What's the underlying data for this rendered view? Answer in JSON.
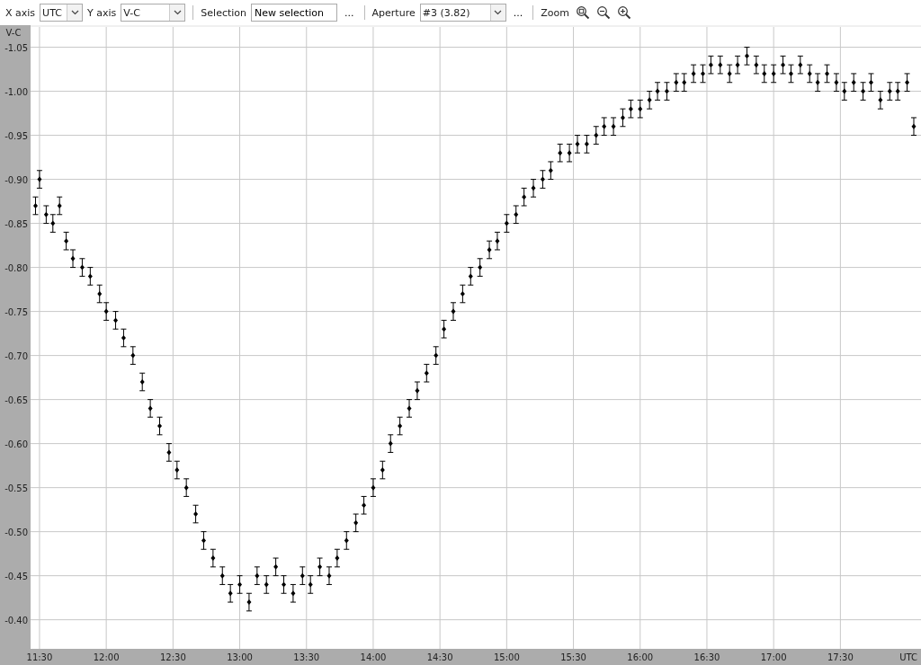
{
  "toolbar": {
    "x_axis": {
      "label": "X axis",
      "value": "UTC"
    },
    "y_axis": {
      "label": "Y axis",
      "value": "V-C"
    },
    "selection": {
      "label": "Selection",
      "value": "New selection",
      "more": "..."
    },
    "aperture": {
      "label": "Aperture",
      "value": "#3 (3.82)",
      "more": "..."
    },
    "zoom": {
      "label": "Zoom"
    }
  },
  "chart": {
    "chart_data": {
      "type": "scatter",
      "xlabel": "UTC",
      "ylabel": "V-C",
      "grid": true,
      "xlim": [
        11.433,
        18.104
      ],
      "ylim": [
        -0.367,
        -1.073
      ],
      "xticks": [
        {
          "value": 11.5,
          "label": "11:30"
        },
        {
          "value": 12,
          "label": "12:00"
        },
        {
          "value": 12.5,
          "label": "12:30"
        },
        {
          "value": 13,
          "label": "13:00"
        },
        {
          "value": 13.5,
          "label": "13:30"
        },
        {
          "value": 14,
          "label": "14:00"
        },
        {
          "value": 14.5,
          "label": "14:30"
        },
        {
          "value": 15,
          "label": "15:00"
        },
        {
          "value": 15.5,
          "label": "15:30"
        },
        {
          "value": 16,
          "label": "16:00"
        },
        {
          "value": 16.5,
          "label": "16:30"
        },
        {
          "value": 17,
          "label": "17:00"
        },
        {
          "value": 17.5,
          "label": "17:30"
        }
      ],
      "yticks": [
        {
          "value": -1.05,
          "label": "-1.05"
        },
        {
          "value": -1.0,
          "label": "-1.00"
        },
        {
          "value": -0.95,
          "label": "-0.95"
        },
        {
          "value": -0.9,
          "label": "-0.90"
        },
        {
          "value": -0.85,
          "label": "-0.85"
        },
        {
          "value": -0.8,
          "label": "-0.80"
        },
        {
          "value": -0.75,
          "label": "-0.75"
        },
        {
          "value": -0.7,
          "label": "-0.70"
        },
        {
          "value": -0.65,
          "label": "-0.65"
        },
        {
          "value": -0.6,
          "label": "-0.60"
        },
        {
          "value": -0.55,
          "label": "-0.55"
        },
        {
          "value": -0.5,
          "label": "-0.50"
        },
        {
          "value": -0.45,
          "label": "-0.45"
        },
        {
          "value": -0.4,
          "label": "-0.40"
        }
      ],
      "x": [
        11.47,
        11.5,
        11.55,
        11.6,
        11.65,
        11.7,
        11.75,
        11.82,
        11.88,
        11.95,
        12.0,
        12.07,
        12.13,
        12.2,
        12.27,
        12.33,
        12.4,
        12.47,
        12.53,
        12.6,
        12.67,
        12.73,
        12.8,
        12.87,
        12.93,
        13.0,
        13.07,
        13.13,
        13.2,
        13.27,
        13.33,
        13.4,
        13.47,
        13.53,
        13.6,
        13.67,
        13.73,
        13.8,
        13.87,
        13.93,
        14.0,
        14.07,
        14.13,
        14.2,
        14.27,
        14.33,
        14.4,
        14.47,
        14.53,
        14.6,
        14.67,
        14.73,
        14.8,
        14.87,
        14.93,
        15.0,
        15.07,
        15.13,
        15.2,
        15.27,
        15.33,
        15.4,
        15.47,
        15.53,
        15.6,
        15.67,
        15.73,
        15.8,
        15.87,
        15.93,
        16.0,
        16.07,
        16.13,
        16.2,
        16.27,
        16.33,
        16.4,
        16.47,
        16.53,
        16.6,
        16.67,
        16.73,
        16.8,
        16.87,
        16.93,
        17.0,
        17.07,
        17.13,
        17.2,
        17.27,
        17.33,
        17.4,
        17.47,
        17.53,
        17.6,
        17.67,
        17.73,
        17.8,
        17.87,
        17.93,
        18.0,
        18.05
      ],
      "series": [
        {
          "color": "#000000",
          "errors": [
            0.01,
            0.01,
            0.01,
            0.01,
            0.01,
            0.01,
            0.01,
            0.01,
            0.01,
            0.01,
            0.01,
            0.01,
            0.01,
            0.01,
            0.01,
            0.01,
            0.01,
            0.01,
            0.01,
            0.01,
            0.01,
            0.01,
            0.01,
            0.01,
            0.01,
            0.01,
            0.01,
            0.01,
            0.01,
            0.01,
            0.01,
            0.01,
            0.01,
            0.01,
            0.01,
            0.01,
            0.01,
            0.01,
            0.01,
            0.01,
            0.01,
            0.01,
            0.01,
            0.01,
            0.01,
            0.01,
            0.01,
            0.01,
            0.01,
            0.01,
            0.01,
            0.01,
            0.01,
            0.01,
            0.01,
            0.01,
            0.01,
            0.01,
            0.01,
            0.01,
            0.01,
            0.01,
            0.01,
            0.01,
            0.01,
            0.01,
            0.01,
            0.01,
            0.01,
            0.01,
            0.01,
            0.01,
            0.01,
            0.01,
            0.01,
            0.01,
            0.01,
            0.01,
            0.01,
            0.01,
            0.01,
            0.01,
            0.01,
            0.01,
            0.01,
            0.01,
            0.01,
            0.01,
            0.01,
            0.01,
            0.01,
            0.01,
            0.01,
            0.01,
            0.01,
            0.01,
            0.01,
            0.01,
            0.01,
            0.01,
            0.01,
            0.01
          ],
          "values": [
            -0.87,
            -0.9,
            -0.86,
            -0.85,
            -0.87,
            -0.83,
            -0.81,
            -0.8,
            -0.79,
            -0.77,
            -0.75,
            -0.74,
            -0.72,
            -0.7,
            -0.67,
            -0.64,
            -0.62,
            -0.59,
            -0.57,
            -0.55,
            -0.52,
            -0.49,
            -0.47,
            -0.45,
            -0.43,
            -0.44,
            -0.42,
            -0.45,
            -0.44,
            -0.46,
            -0.44,
            -0.43,
            -0.45,
            -0.44,
            -0.46,
            -0.45,
            -0.47,
            -0.49,
            -0.51,
            -0.53,
            -0.55,
            -0.57,
            -0.6,
            -0.62,
            -0.64,
            -0.66,
            -0.68,
            -0.7,
            -0.73,
            -0.75,
            -0.77,
            -0.79,
            -0.8,
            -0.82,
            -0.83,
            -0.85,
            -0.86,
            -0.88,
            -0.89,
            -0.9,
            -0.91,
            -0.93,
            -0.93,
            -0.94,
            -0.94,
            -0.95,
            -0.96,
            -0.96,
            -0.97,
            -0.98,
            -0.98,
            -0.99,
            -1.0,
            -1.0,
            -1.01,
            -1.01,
            -1.02,
            -1.02,
            -1.03,
            -1.03,
            -1.02,
            -1.03,
            -1.04,
            -1.03,
            -1.02,
            -1.02,
            -1.03,
            -1.02,
            -1.03,
            -1.02,
            -1.01,
            -1.02,
            -1.01,
            -1.0,
            -1.01,
            -1.0,
            -1.01,
            -0.99,
            -1.0,
            -1.0,
            -1.01,
            -0.96
          ]
        }
      ]
    }
  }
}
